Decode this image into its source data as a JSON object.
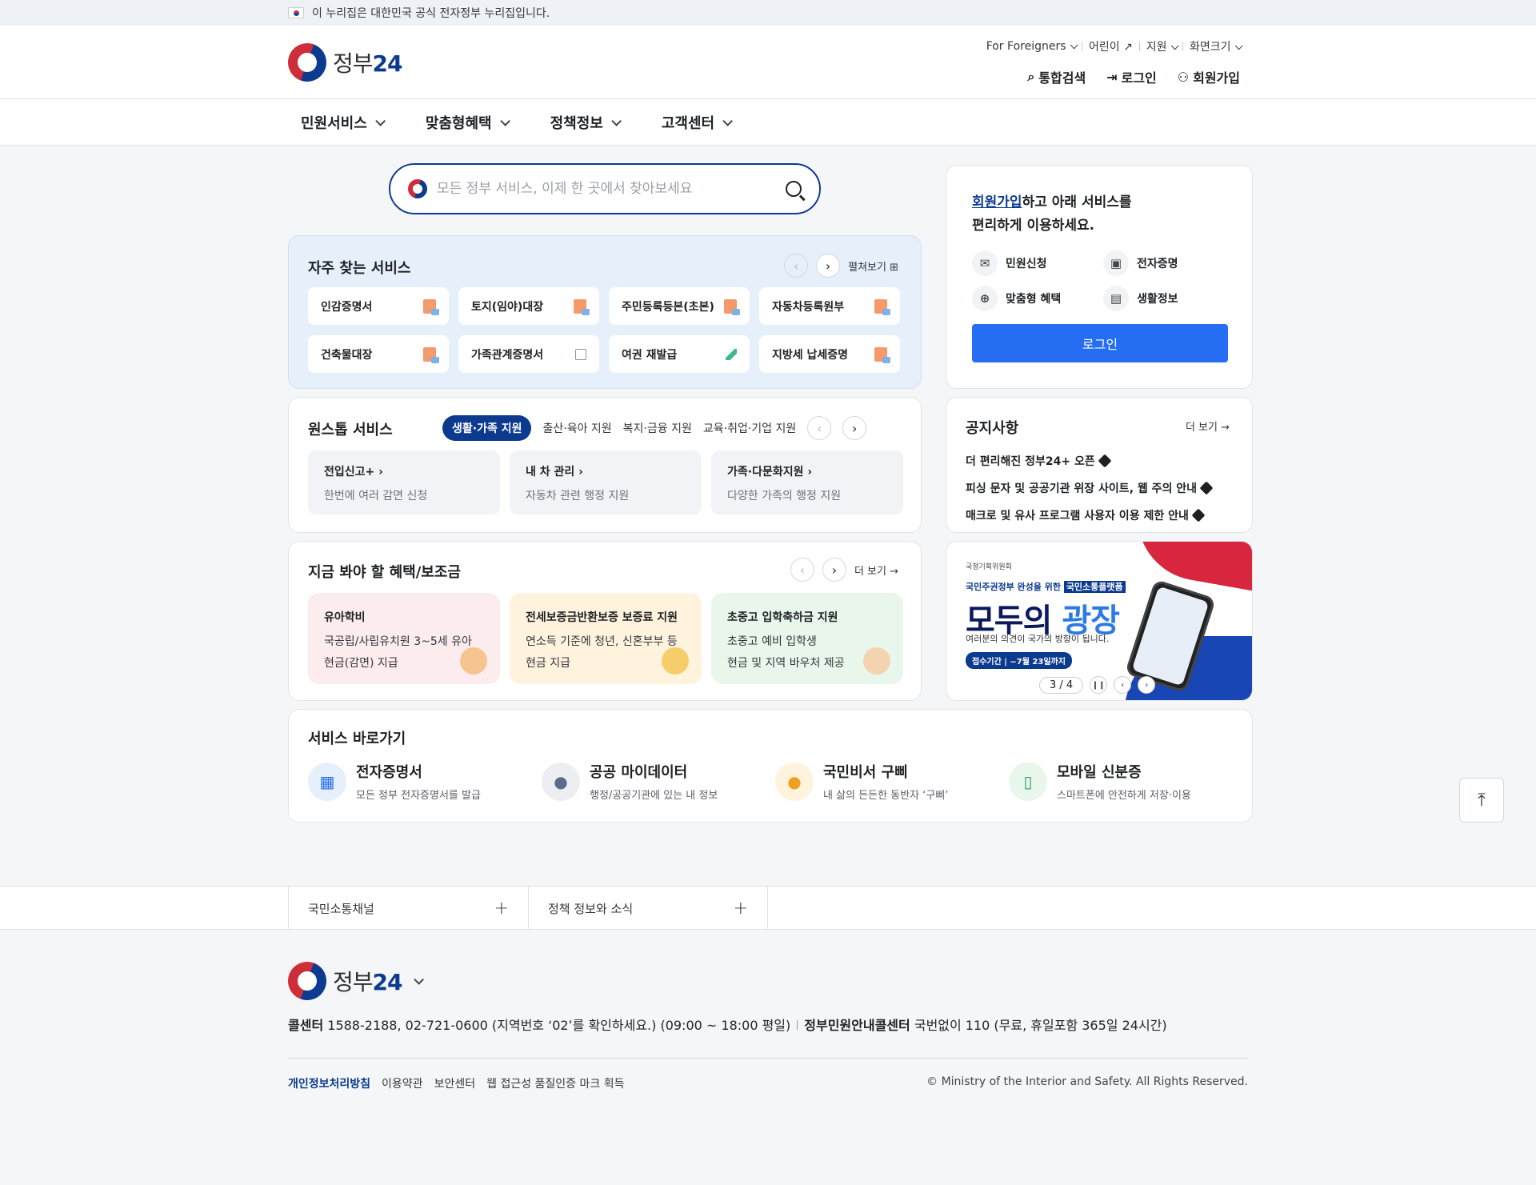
{
  "gov_banner": {
    "text": "이 누리집은 대한민국 공식 전자정부 누리집입니다."
  },
  "brand": {
    "name_kr": "정부",
    "name_num": "24"
  },
  "utility": {
    "foreigners": "For Foreigners",
    "kids": "어린이",
    "support": "지원",
    "screen_size": "화면크기"
  },
  "header_actions": {
    "search": "통합검색",
    "login": "로그인",
    "signup": "회원가입"
  },
  "main_nav": [
    "민원서비스",
    "맞춤형혜택",
    "정책정보",
    "고객센터"
  ],
  "search": {
    "placeholder": "모든 정부 서비스, 이제 한 곳에서 찾아보세요"
  },
  "frequent": {
    "title": "자주 찾는 서비스",
    "expand": "펼쳐보기",
    "items": [
      "인감증명서",
      "토지(임야)대장",
      "주민등록등본(초본)",
      "자동차등록원부",
      "건축물대장",
      "가족관계증명서",
      "여권 재발급",
      "지방세 납세증명"
    ]
  },
  "login_card": {
    "signup_link": "회원가입",
    "msg1": "하고 아래 서비스를",
    "msg2": "편리하게 이용하세요.",
    "features": [
      "민원신청",
      "전자증명",
      "맞춤형 혜택",
      "생활정보"
    ],
    "button": "로그인"
  },
  "onestop": {
    "title": "원스톱 서비스",
    "tabs": [
      "생활·가족 지원",
      "출산·육아 지원",
      "복지·금융 지원",
      "교육·취업·기업 지원"
    ],
    "items": [
      {
        "title": "전입신고+",
        "desc": "한번에 여러 감면 신청"
      },
      {
        "title": "내 차 관리",
        "desc": "자동차 관련 행정 지원"
      },
      {
        "title": "가족·다문화지원",
        "desc": "다양한 가족의 행정 지원"
      }
    ]
  },
  "notice": {
    "title": "공지사항",
    "more": "더 보기",
    "items": [
      "더 편리해진 정부24+ 오픈",
      "피싱 문자 및 공공기관 위장 사이트, 웹 주의 안내",
      "매크로 및 유사 프로그램 사용자 이용 제한 안내"
    ]
  },
  "benefits": {
    "title": "지금 봐야 할 혜택/보조금",
    "more": "더 보기",
    "items": [
      {
        "title": "유아학비",
        "line1": "국공립/사립유치원 3~5세 유아",
        "line2": "현금(감면) 지급"
      },
      {
        "title": "전세보증금반환보증 보증료 지원",
        "line1": "연소득 기준에 청년, 신혼부부 등",
        "line2": "현금 지급"
      },
      {
        "title": "초중고 입학축하금 지원",
        "line1": "초중고 예비 입학생",
        "line2": "현금 및 지역 바우처 제공"
      }
    ],
    "colors": [
      "#fdecee",
      "#fff3de",
      "#e9f6ec"
    ]
  },
  "promo": {
    "org": "국정기획위원회",
    "sub_prefix": "국민주권정부 완성을 위한 ",
    "sub_highlight": "국민소통플랫폼",
    "headline_a": "모두의 ",
    "headline_b": "광장",
    "desc": "여러분의 의견이 국가의 방향이 됩니다.",
    "period": "접수기간 | ~7월 23일까지",
    "pager": "3 / 4"
  },
  "shortcuts": {
    "title": "서비스 바로가기",
    "items": [
      {
        "title": "전자증명서",
        "desc": "모든 정부 전자증명서를 발급",
        "icon": "certificate-icon",
        "bg": "#e6f0fb"
      },
      {
        "title": "공공 마이데이터",
        "desc": "행정/공공기관에 있는 내 정보",
        "icon": "person-icon",
        "bg": "#eceef2"
      },
      {
        "title": "국민비서 구삐",
        "desc": "내 삶의 든든한 동반자 ‘구삐’",
        "icon": "chat-icon",
        "bg": "#fff3de"
      },
      {
        "title": "모바일 신분증",
        "desc": "스마트폰에 안전하게 저장·이용",
        "icon": "mobile-id-icon",
        "bg": "#e9f6ec"
      }
    ]
  },
  "footer_links": [
    "국민소통채널",
    "정책 정보와 소식"
  ],
  "footer": {
    "callcenter_label": "콜센터",
    "callcenter": "1588-2188, 02-721-0600 (지역번호 ‘02’를 확인하세요.) (09:00 ~ 18:00 평일)",
    "gov_center_label": "정부민원안내콜센터",
    "gov_center": "국번없이 110 (무료, 휴일포함 365일 24시간)",
    "policy": [
      "개인정보처리방침",
      "이용약관",
      "보안센터",
      "웹 접근성 품질인증 마크 획득"
    ],
    "copyright": "© Ministry of the Interior and Safety. All Rights Reserved."
  }
}
